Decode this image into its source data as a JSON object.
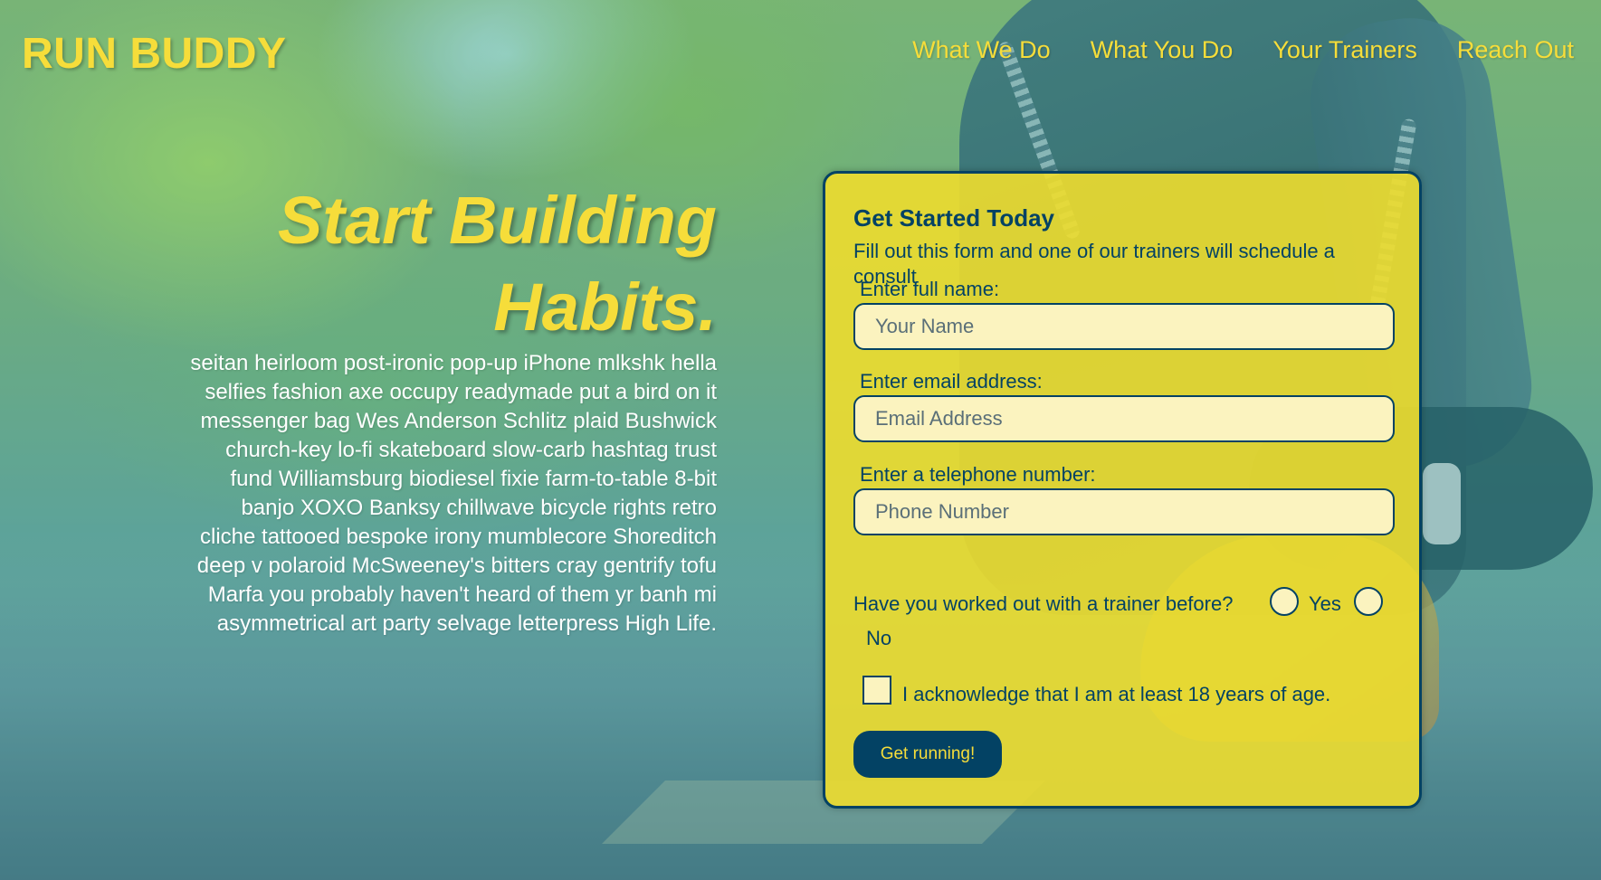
{
  "brand": {
    "name": "RUN BUDDY"
  },
  "nav": {
    "items": [
      "What We Do",
      "What You Do",
      "Your Trainers",
      "Reach Out"
    ]
  },
  "hero": {
    "title_line1": "Start Building",
    "title_line2": "Habits.",
    "body": "seitan heirloom post-ironic pop-up iPhone mlkshk hella selfies fashion axe occupy readymade put a bird on it messenger bag Wes Anderson Schlitz plaid Bushwick church-key lo-fi skateboard slow-carb hashtag trust fund Williamsburg biodiesel fixie farm-to-table 8-bit banjo XOXO Banksy chillwave bicycle rights retro cliche tattooed bespoke irony mumblecore Shoreditch deep v polaroid McSweeney's bitters cray gentrify tofu Marfa you probably haven't heard of them yr banh mi asymmetrical art party selvage letterpress High Life."
  },
  "form": {
    "title": "Get Started Today",
    "subtitle": "Fill out this form and one of our trainers will schedule a consult",
    "name_label": "Enter full name:",
    "name_placeholder": "Your Name",
    "email_label": "Enter email address:",
    "email_placeholder": "Email Address",
    "phone_label": "Enter a telephone number:",
    "phone_placeholder": "Phone Number",
    "trainer_question": "Have you worked out with a trainer before?",
    "yes_label": "Yes",
    "no_label": "No",
    "age_ack": "I acknowledge that I am at least 18 years of age.",
    "submit_label": "Get running!"
  },
  "colors": {
    "accent_yellow": "#f6dd3a",
    "navy": "#034264",
    "card_yellow": "#eedd2e"
  }
}
